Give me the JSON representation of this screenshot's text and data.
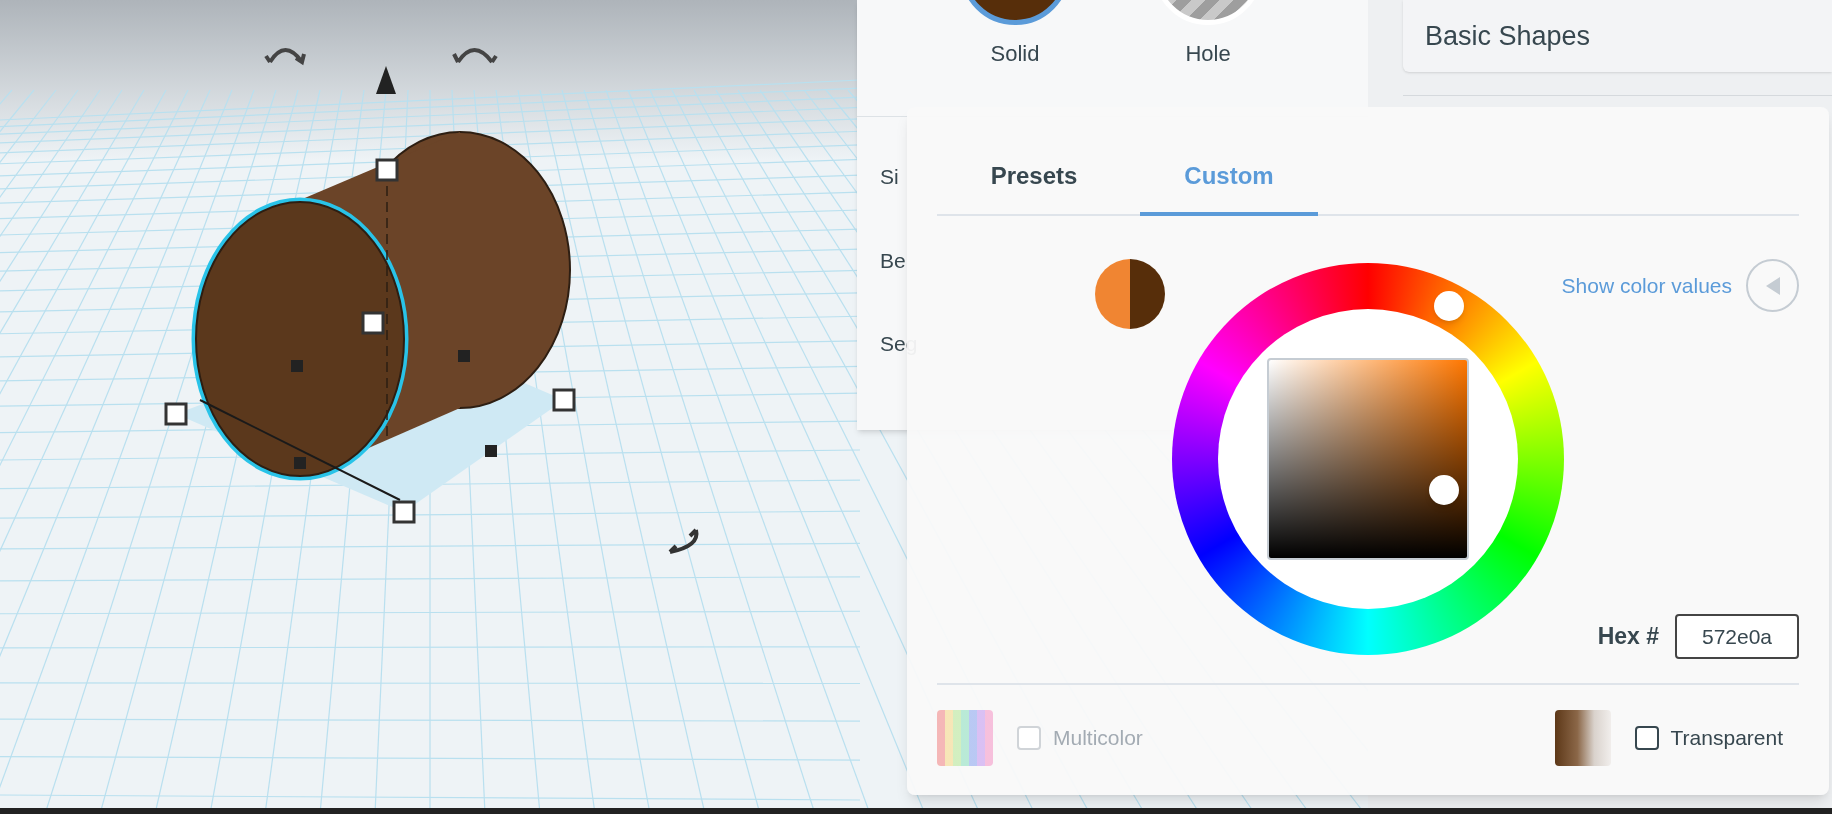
{
  "mode_options": [
    {
      "label": "Solid",
      "kind": "solid",
      "selected": true
    },
    {
      "label": "Hole",
      "kind": "hole",
      "selected": false
    }
  ],
  "shape_properties": [
    "Si",
    "Be",
    "Seg"
  ],
  "library": {
    "title": "Basic Shapes"
  },
  "color_popover": {
    "tabs": [
      {
        "label": "Presets",
        "selected": false
      },
      {
        "label": "Custom",
        "selected": true
      }
    ],
    "swatch": [
      {
        "color": "#f08532"
      },
      {
        "color": "#572e0a"
      }
    ],
    "show_values": {
      "label": "Show color values",
      "expanded": false
    },
    "hex": {
      "label": "Hex #",
      "value": "572e0a"
    },
    "options": [
      {
        "label": "Multicolor",
        "kind": "multicolor",
        "checked": false,
        "disabled": true
      },
      {
        "label": "Transparent",
        "kind": "transparent",
        "checked": false,
        "disabled": false
      }
    ]
  }
}
